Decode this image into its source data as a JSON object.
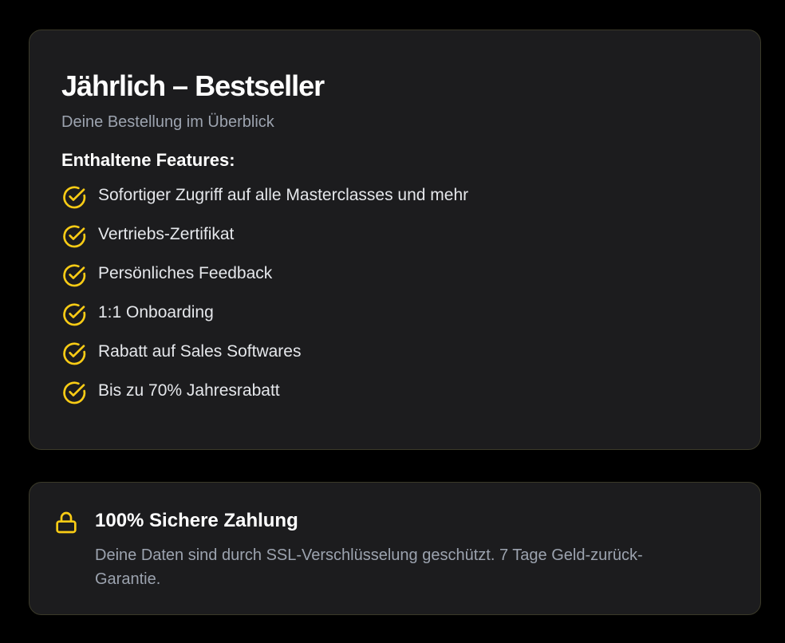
{
  "plan": {
    "title": "Jährlich – Bestseller",
    "subtitle": "Deine Bestellung im Überblick",
    "features_heading": "Enthaltene Features:",
    "features": [
      {
        "label": "Sofortiger Zugriff auf alle Masterclasses und mehr",
        "icon": "check-circle-icon"
      },
      {
        "label": "Vertriebs-Zertifikat",
        "icon": "check-circle-icon"
      },
      {
        "label": "Persönliches Feedback",
        "icon": "check-circle-icon"
      },
      {
        "label": "1:1 Onboarding",
        "icon": "check-circle-icon"
      },
      {
        "label": "Rabatt auf Sales Softwares",
        "icon": "check-circle-icon"
      },
      {
        "label": "Bis zu 70% Jahresrabatt",
        "icon": "check-circle-icon"
      }
    ]
  },
  "security": {
    "icon": "lock-icon",
    "title": "100% Sichere Zahlung",
    "description": "Deine Daten sind durch SSL-Verschlüsselung geschützt. 7 Tage Geld-zurück-Garantie."
  },
  "colors": {
    "background": "#000000",
    "card_background": "#1c1c1e",
    "card_border": "#3b3a29",
    "accent": "#facc15",
    "muted_text": "#9ca3af"
  }
}
